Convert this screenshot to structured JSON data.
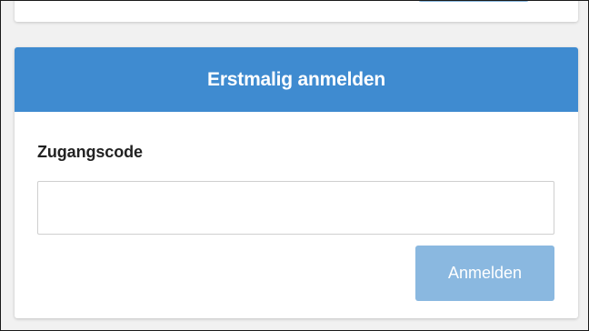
{
  "login_card": {
    "title": "Erstmalig anmelden",
    "access_code_label": "Zugangscode",
    "access_code_value": "",
    "access_code_placeholder": "",
    "submit_label": "Anmelden"
  },
  "colors": {
    "header_blue": "#3f8bd0",
    "button_disabled_blue": "#8ab8e0",
    "page_background": "#f1f1f1"
  }
}
